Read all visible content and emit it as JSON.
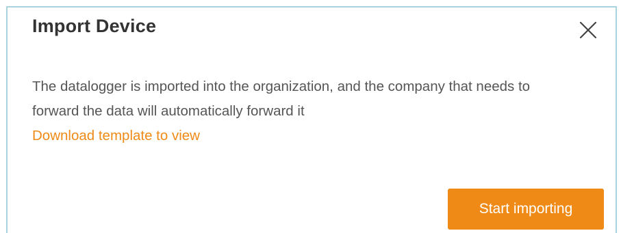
{
  "dialog": {
    "title": "Import Device",
    "close_icon": "close-icon",
    "description": "The datalogger is imported into the organization, and the company that needs to forward the data will automatically forward it",
    "download_link": "Download template to view",
    "start_button": "Start importing"
  },
  "colors": {
    "accent": "#ef8a16",
    "border": "#a9d3df",
    "title_text": "#333333",
    "body_text": "#555555"
  }
}
